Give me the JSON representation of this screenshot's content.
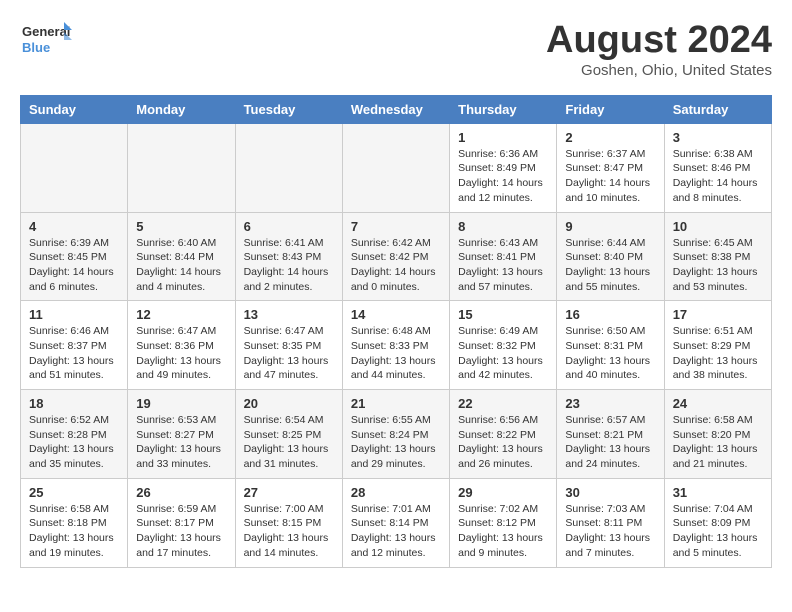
{
  "header": {
    "logo_line1": "General",
    "logo_line2": "Blue",
    "month": "August 2024",
    "location": "Goshen, Ohio, United States"
  },
  "weekdays": [
    "Sunday",
    "Monday",
    "Tuesday",
    "Wednesday",
    "Thursday",
    "Friday",
    "Saturday"
  ],
  "weeks": [
    [
      {
        "day": "",
        "empty": true
      },
      {
        "day": "",
        "empty": true
      },
      {
        "day": "",
        "empty": true
      },
      {
        "day": "",
        "empty": true
      },
      {
        "day": "1",
        "sunrise": "Sunrise: 6:36 AM",
        "sunset": "Sunset: 8:49 PM",
        "daylight": "Daylight: 14 hours and 12 minutes."
      },
      {
        "day": "2",
        "sunrise": "Sunrise: 6:37 AM",
        "sunset": "Sunset: 8:47 PM",
        "daylight": "Daylight: 14 hours and 10 minutes."
      },
      {
        "day": "3",
        "sunrise": "Sunrise: 6:38 AM",
        "sunset": "Sunset: 8:46 PM",
        "daylight": "Daylight: 14 hours and 8 minutes."
      }
    ],
    [
      {
        "day": "4",
        "sunrise": "Sunrise: 6:39 AM",
        "sunset": "Sunset: 8:45 PM",
        "daylight": "Daylight: 14 hours and 6 minutes."
      },
      {
        "day": "5",
        "sunrise": "Sunrise: 6:40 AM",
        "sunset": "Sunset: 8:44 PM",
        "daylight": "Daylight: 14 hours and 4 minutes."
      },
      {
        "day": "6",
        "sunrise": "Sunrise: 6:41 AM",
        "sunset": "Sunset: 8:43 PM",
        "daylight": "Daylight: 14 hours and 2 minutes."
      },
      {
        "day": "7",
        "sunrise": "Sunrise: 6:42 AM",
        "sunset": "Sunset: 8:42 PM",
        "daylight": "Daylight: 14 hours and 0 minutes."
      },
      {
        "day": "8",
        "sunrise": "Sunrise: 6:43 AM",
        "sunset": "Sunset: 8:41 PM",
        "daylight": "Daylight: 13 hours and 57 minutes."
      },
      {
        "day": "9",
        "sunrise": "Sunrise: 6:44 AM",
        "sunset": "Sunset: 8:40 PM",
        "daylight": "Daylight: 13 hours and 55 minutes."
      },
      {
        "day": "10",
        "sunrise": "Sunrise: 6:45 AM",
        "sunset": "Sunset: 8:38 PM",
        "daylight": "Daylight: 13 hours and 53 minutes."
      }
    ],
    [
      {
        "day": "11",
        "sunrise": "Sunrise: 6:46 AM",
        "sunset": "Sunset: 8:37 PM",
        "daylight": "Daylight: 13 hours and 51 minutes."
      },
      {
        "day": "12",
        "sunrise": "Sunrise: 6:47 AM",
        "sunset": "Sunset: 8:36 PM",
        "daylight": "Daylight: 13 hours and 49 minutes."
      },
      {
        "day": "13",
        "sunrise": "Sunrise: 6:47 AM",
        "sunset": "Sunset: 8:35 PM",
        "daylight": "Daylight: 13 hours and 47 minutes."
      },
      {
        "day": "14",
        "sunrise": "Sunrise: 6:48 AM",
        "sunset": "Sunset: 8:33 PM",
        "daylight": "Daylight: 13 hours and 44 minutes."
      },
      {
        "day": "15",
        "sunrise": "Sunrise: 6:49 AM",
        "sunset": "Sunset: 8:32 PM",
        "daylight": "Daylight: 13 hours and 42 minutes."
      },
      {
        "day": "16",
        "sunrise": "Sunrise: 6:50 AM",
        "sunset": "Sunset: 8:31 PM",
        "daylight": "Daylight: 13 hours and 40 minutes."
      },
      {
        "day": "17",
        "sunrise": "Sunrise: 6:51 AM",
        "sunset": "Sunset: 8:29 PM",
        "daylight": "Daylight: 13 hours and 38 minutes."
      }
    ],
    [
      {
        "day": "18",
        "sunrise": "Sunrise: 6:52 AM",
        "sunset": "Sunset: 8:28 PM",
        "daylight": "Daylight: 13 hours and 35 minutes."
      },
      {
        "day": "19",
        "sunrise": "Sunrise: 6:53 AM",
        "sunset": "Sunset: 8:27 PM",
        "daylight": "Daylight: 13 hours and 33 minutes."
      },
      {
        "day": "20",
        "sunrise": "Sunrise: 6:54 AM",
        "sunset": "Sunset: 8:25 PM",
        "daylight": "Daylight: 13 hours and 31 minutes."
      },
      {
        "day": "21",
        "sunrise": "Sunrise: 6:55 AM",
        "sunset": "Sunset: 8:24 PM",
        "daylight": "Daylight: 13 hours and 29 minutes."
      },
      {
        "day": "22",
        "sunrise": "Sunrise: 6:56 AM",
        "sunset": "Sunset: 8:22 PM",
        "daylight": "Daylight: 13 hours and 26 minutes."
      },
      {
        "day": "23",
        "sunrise": "Sunrise: 6:57 AM",
        "sunset": "Sunset: 8:21 PM",
        "daylight": "Daylight: 13 hours and 24 minutes."
      },
      {
        "day": "24",
        "sunrise": "Sunrise: 6:58 AM",
        "sunset": "Sunset: 8:20 PM",
        "daylight": "Daylight: 13 hours and 21 minutes."
      }
    ],
    [
      {
        "day": "25",
        "sunrise": "Sunrise: 6:58 AM",
        "sunset": "Sunset: 8:18 PM",
        "daylight": "Daylight: 13 hours and 19 minutes."
      },
      {
        "day": "26",
        "sunrise": "Sunrise: 6:59 AM",
        "sunset": "Sunset: 8:17 PM",
        "daylight": "Daylight: 13 hours and 17 minutes."
      },
      {
        "day": "27",
        "sunrise": "Sunrise: 7:00 AM",
        "sunset": "Sunset: 8:15 PM",
        "daylight": "Daylight: 13 hours and 14 minutes."
      },
      {
        "day": "28",
        "sunrise": "Sunrise: 7:01 AM",
        "sunset": "Sunset: 8:14 PM",
        "daylight": "Daylight: 13 hours and 12 minutes."
      },
      {
        "day": "29",
        "sunrise": "Sunrise: 7:02 AM",
        "sunset": "Sunset: 8:12 PM",
        "daylight": "Daylight: 13 hours and 9 minutes."
      },
      {
        "day": "30",
        "sunrise": "Sunrise: 7:03 AM",
        "sunset": "Sunset: 8:11 PM",
        "daylight": "Daylight: 13 hours and 7 minutes."
      },
      {
        "day": "31",
        "sunrise": "Sunrise: 7:04 AM",
        "sunset": "Sunset: 8:09 PM",
        "daylight": "Daylight: 13 hours and 5 minutes."
      }
    ]
  ]
}
